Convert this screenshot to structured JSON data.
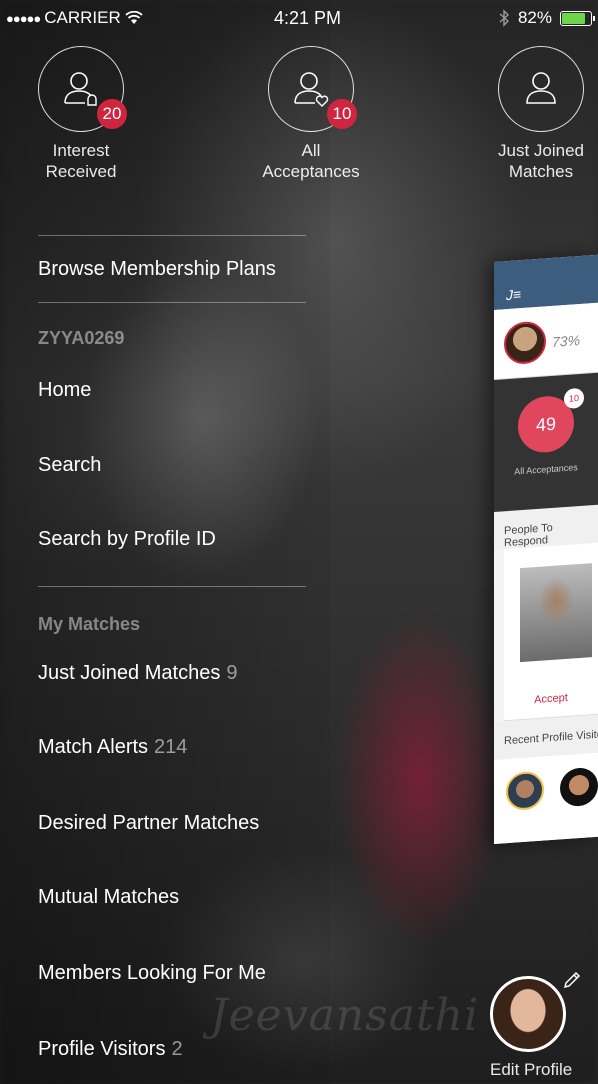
{
  "status_bar": {
    "carrier": "CARRIER",
    "time": "4:21 PM",
    "battery": "82%",
    "battery_level": 0.82,
    "battery_color": "#6ed44a"
  },
  "quick_actions": [
    {
      "label": "Interest\nReceived",
      "badge": "20",
      "icon": "user-bell-icon"
    },
    {
      "label": "All\nAcceptances",
      "badge": "10",
      "icon": "user-heart-icon"
    },
    {
      "label": "Just Joined\nMatches",
      "badge": "",
      "icon": "user-icon"
    }
  ],
  "menu": {
    "browse_plans": "Browse Membership Plans",
    "user_id": "ZYYA0269",
    "home": "Home",
    "search": "Search",
    "search_by_id": "Search by Profile ID",
    "my_matches_header": "My Matches",
    "just_joined": {
      "label": "Just Joined Matches",
      "count": "9"
    },
    "match_alerts": {
      "label": "Match Alerts",
      "count": "214"
    },
    "desired_partner": "Desired Partner Matches",
    "mutual_matches": "Mutual Matches",
    "members_looking": "Members Looking For Me",
    "profile_visitors": {
      "label": "Profile Visitors",
      "count": "2"
    }
  },
  "preview": {
    "profile_percent": "73%",
    "acceptances_count": "49",
    "acceptances_badge": "10",
    "acceptances_label": "All Acceptances",
    "people_to_respond": "People To Respond",
    "accept": "Accept",
    "recent_visitors": "Recent Profile Visitors"
  },
  "background_logo": "Jeevansathi",
  "edit_profile": "Edit Profile",
  "colors": {
    "badge": "#d0253f",
    "header": "#3c5d7e"
  }
}
